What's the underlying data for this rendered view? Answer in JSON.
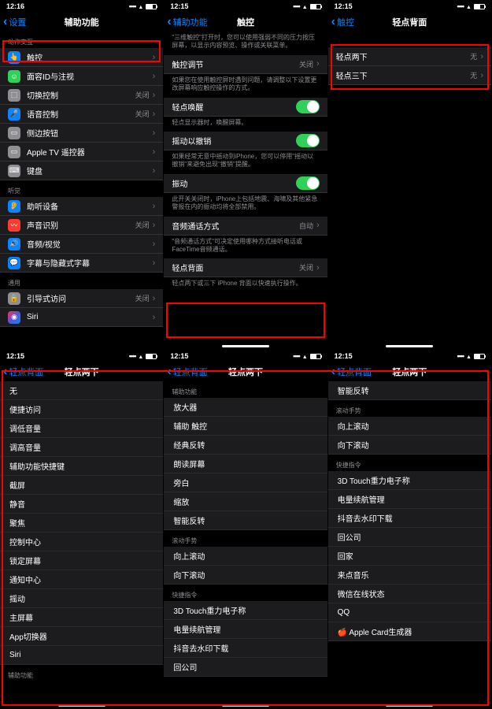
{
  "panels": {
    "p1": {
      "time": "12:16",
      "back": "设置",
      "title": "辅助功能",
      "sec1_header": "动作交互",
      "touch": "触控",
      "faceid": "面容ID与注视",
      "switch_control": "切换控制",
      "switch_control_val": "关闭",
      "voice_control": "语音控制",
      "voice_control_val": "关闭",
      "side_button": "侧边按钮",
      "apple_tv": "Apple TV 遥控器",
      "keyboard": "键盘",
      "sec2_header": "听觉",
      "hearing": "助听设备",
      "sound_rec": "声音识别",
      "sound_rec_val": "关闭",
      "av": "音频/视觉",
      "subtitles": "字幕与隐藏式字幕",
      "sec3_header": "通用",
      "guided": "引导式访问",
      "guided_val": "关闭",
      "siri": "Siri"
    },
    "p2": {
      "time": "12:15",
      "back": "辅助功能",
      "title": "触控",
      "intro": "\"三维触控\"打开时，您可以使用强弱不同的压力按压屏幕，以显示内容预览、操作或关联菜单。",
      "touch_accom": "触控调节",
      "touch_accom_val": "关闭",
      "touch_accom_desc": "如果您在使用触控屏时遇到问题，请调整以下设置更改屏幕响应触控操作的方式。",
      "tap_wake": "轻点唤醒",
      "tap_wake_desc": "轻点显示器时，唤醒屏幕。",
      "shake_undo": "摇动以撤销",
      "shake_undo_desc": "如果经常无意中摇动到iPhone，您可以停用\"摇动以撤销\"来避免出现\"撤销\"提醒。",
      "vibration": "振动",
      "vibration_desc": "此开关关闭时，iPhone上包括地震、海啸及其他紧急警报在内的振动均将全部禁用。",
      "audio_mode": "音频通话方式",
      "audio_mode_val": "自动",
      "audio_desc": "\"音频通话方式\"可决定使用哪种方式接听电话或FaceTime音频通话。",
      "back_tap": "轻点背面",
      "back_tap_val": "关闭",
      "back_tap_desc": "轻点两下或三下 iPhone 背面以快速执行操作。"
    },
    "p3": {
      "time": "12:15",
      "back": "触控",
      "title": "轻点背面",
      "double_tap": "轻点两下",
      "double_tap_val": "无",
      "triple_tap": "轻点三下",
      "triple_tap_val": "无"
    },
    "p4": {
      "time": "12:15",
      "back": "轻点背面",
      "title": "轻点两下",
      "items": [
        "无",
        "便捷访问",
        "调低音量",
        "调高音量",
        "辅助功能快捷键",
        "截屏",
        "静音",
        "聚焦",
        "控制中心",
        "锁定屏幕",
        "通知中心",
        "摇动",
        "主屏幕",
        "App切换器",
        "Siri"
      ],
      "footer_header": "辅助功能"
    },
    "p5": {
      "time": "12:15",
      "back": "轻点背面",
      "title": "轻点两下",
      "sec1": "辅助功能",
      "items1": [
        "放大器",
        "辅助 触控",
        "经典反转",
        "朗读屏幕",
        "旁白",
        "缩放",
        "智能反转"
      ],
      "sec2": "滚动手势",
      "items2": [
        "向上滚动",
        "向下滚动"
      ],
      "sec3": "快捷指令",
      "items3": [
        "3D Touch重力电子称",
        "电量续航管理",
        "抖音去水印下载",
        "回公司"
      ]
    },
    "p6": {
      "time": "12:15",
      "back": "轻点背面",
      "title": "轻点两下",
      "items0": [
        "智能反转"
      ],
      "sec1": "滚动手势",
      "items1": [
        "向上滚动",
        "向下滚动"
      ],
      "sec2": "快捷指令",
      "items2": [
        "3D Touch重力电子称",
        "电量续航管理",
        "抖音去水印下载",
        "回公司",
        "回家",
        "来点音乐",
        "微信在线状态",
        "QQ",
        "🍎 Apple Card生成器"
      ]
    }
  }
}
